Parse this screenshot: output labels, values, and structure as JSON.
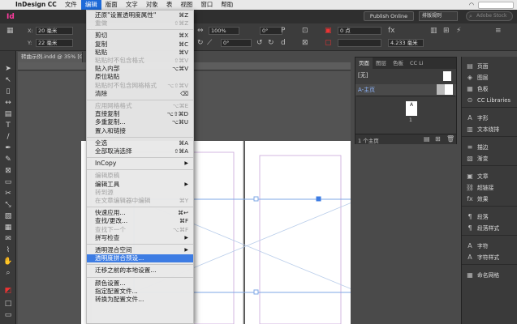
{
  "macmenu": {
    "app": "InDesign CC",
    "items": [
      "文件",
      "编辑",
      "版面",
      "文字",
      "对象",
      "表",
      "视图",
      "窗口",
      "帮助"
    ],
    "active_index": 1
  },
  "appbar": {
    "logo": "Id",
    "publish_label": "Publish Online",
    "workspace_label": "排版规则",
    "search_placeholder": "Adobe Stock"
  },
  "control": {
    "x_label": "X:",
    "x_value": "20 毫米",
    "y_label": "Y:",
    "y_value": "22 毫米",
    "stroke_value": "0 点",
    "percent_value": "100%",
    "angle_value": "0°",
    "angle2_value": "0°",
    "mm_value": "4.233 毫米"
  },
  "document_tab": "转曲示例.indd @ 35% [GPU 预览]",
  "edit_menu": [
    {
      "label": "还原\"设置透明度属性\"",
      "shortcut": "⌘Z",
      "disabled": false
    },
    {
      "label": "重做",
      "shortcut": "⇧⌘Z",
      "disabled": true
    },
    {
      "sep": true
    },
    {
      "label": "剪切",
      "shortcut": "⌘X",
      "disabled": false
    },
    {
      "label": "复制",
      "shortcut": "⌘C",
      "disabled": false
    },
    {
      "label": "粘贴",
      "shortcut": "⌘V",
      "disabled": false
    },
    {
      "label": "粘贴时不包含格式",
      "shortcut": "⇧⌘V",
      "disabled": true
    },
    {
      "label": "贴入内部",
      "shortcut": "⌥⌘V",
      "disabled": false
    },
    {
      "label": "原位粘贴",
      "shortcut": "",
      "disabled": false
    },
    {
      "label": "粘贴时不包含网格格式",
      "shortcut": "⌥⇧⌘V",
      "disabled": true
    },
    {
      "label": "清除",
      "shortcut": "⌫",
      "disabled": false
    },
    {
      "sep": true
    },
    {
      "label": "应用网格格式",
      "shortcut": "⌥⌘E",
      "disabled": true
    },
    {
      "label": "直接复制",
      "shortcut": "⌥⇧⌘D",
      "disabled": false
    },
    {
      "label": "多重复制...",
      "shortcut": "⌥⌘U",
      "disabled": false
    },
    {
      "label": "置入和链接",
      "shortcut": "",
      "disabled": false
    },
    {
      "sep": true
    },
    {
      "label": "全选",
      "shortcut": "⌘A",
      "disabled": false
    },
    {
      "label": "全部取消选择",
      "shortcut": "⇧⌘A",
      "disabled": false
    },
    {
      "sep": true
    },
    {
      "label": "InCopy",
      "shortcut": "",
      "submenu": true,
      "disabled": false
    },
    {
      "sep": true
    },
    {
      "label": "编辑原稿",
      "shortcut": "",
      "disabled": true
    },
    {
      "label": "编辑工具",
      "shortcut": "",
      "submenu": true,
      "disabled": false
    },
    {
      "label": "转到源",
      "shortcut": "",
      "disabled": true
    },
    {
      "label": "在文章编辑器中编辑",
      "shortcut": "⌘Y",
      "disabled": true
    },
    {
      "sep": true
    },
    {
      "label": "快速应用...",
      "shortcut": "⌘↩",
      "disabled": false
    },
    {
      "label": "查找/更改...",
      "shortcut": "⌘F",
      "disabled": false
    },
    {
      "label": "查找下一个",
      "shortcut": "⌥⌘F",
      "disabled": true
    },
    {
      "label": "拼写检查",
      "shortcut": "",
      "submenu": true,
      "disabled": false
    },
    {
      "sep": true
    },
    {
      "label": "透明混合空间",
      "shortcut": "",
      "submenu": true,
      "disabled": false
    },
    {
      "label": "透明度拼合预设...",
      "shortcut": "",
      "disabled": false,
      "selected": true
    },
    {
      "sep": true
    },
    {
      "label": "迁移之前的本地设置...",
      "shortcut": "",
      "disabled": false
    },
    {
      "sep": true
    },
    {
      "label": "颜色设置...",
      "shortcut": "",
      "disabled": false
    },
    {
      "label": "指定配置文件...",
      "shortcut": "",
      "disabled": false
    },
    {
      "label": "转换为配置文件...",
      "shortcut": "",
      "disabled": false
    }
  ],
  "pages_panel": {
    "tabs": [
      "页面",
      "图层",
      "色板",
      "CC Li"
    ],
    "none_label": "[无]",
    "master_label": "A-主页",
    "page_number": "1",
    "master_letter": "A",
    "status": "1 个主页"
  },
  "right_dock": [
    {
      "icon": "pages-icon",
      "glyph": "▤",
      "label": "页面"
    },
    {
      "icon": "layers-icon",
      "glyph": "◈",
      "label": "图层"
    },
    {
      "icon": "swatches-icon",
      "glyph": "▦",
      "label": "色板"
    },
    {
      "icon": "cc-libraries-icon",
      "glyph": "⊙",
      "label": "CC Libraries"
    },
    {
      "icon": "character-icon",
      "glyph": "A",
      "label": "字形"
    },
    {
      "icon": "text-wrap-icon",
      "glyph": "▥",
      "label": "文本绕排"
    },
    {
      "icon": "stroke-icon",
      "glyph": "≡",
      "label": "描边"
    },
    {
      "icon": "gradient-icon",
      "glyph": "▧",
      "label": "渐变"
    },
    {
      "icon": "articles-icon",
      "glyph": "▣",
      "label": "文章"
    },
    {
      "icon": "hyperlinks-icon",
      "glyph": "⛓",
      "label": "超链接"
    },
    {
      "icon": "effects-icon",
      "glyph": "fx",
      "label": "效果"
    },
    {
      "icon": "paragraph-icon",
      "glyph": "¶",
      "label": "段落"
    },
    {
      "icon": "paragraph-styles-icon",
      "glyph": "¶",
      "label": "段落样式"
    },
    {
      "icon": "character-panel-icon",
      "glyph": "A",
      "label": "字符"
    },
    {
      "icon": "character-styles-icon",
      "glyph": "A",
      "label": "字符样式"
    },
    {
      "icon": "named-grid-icon",
      "glyph": "▦",
      "label": "命名网格"
    }
  ]
}
